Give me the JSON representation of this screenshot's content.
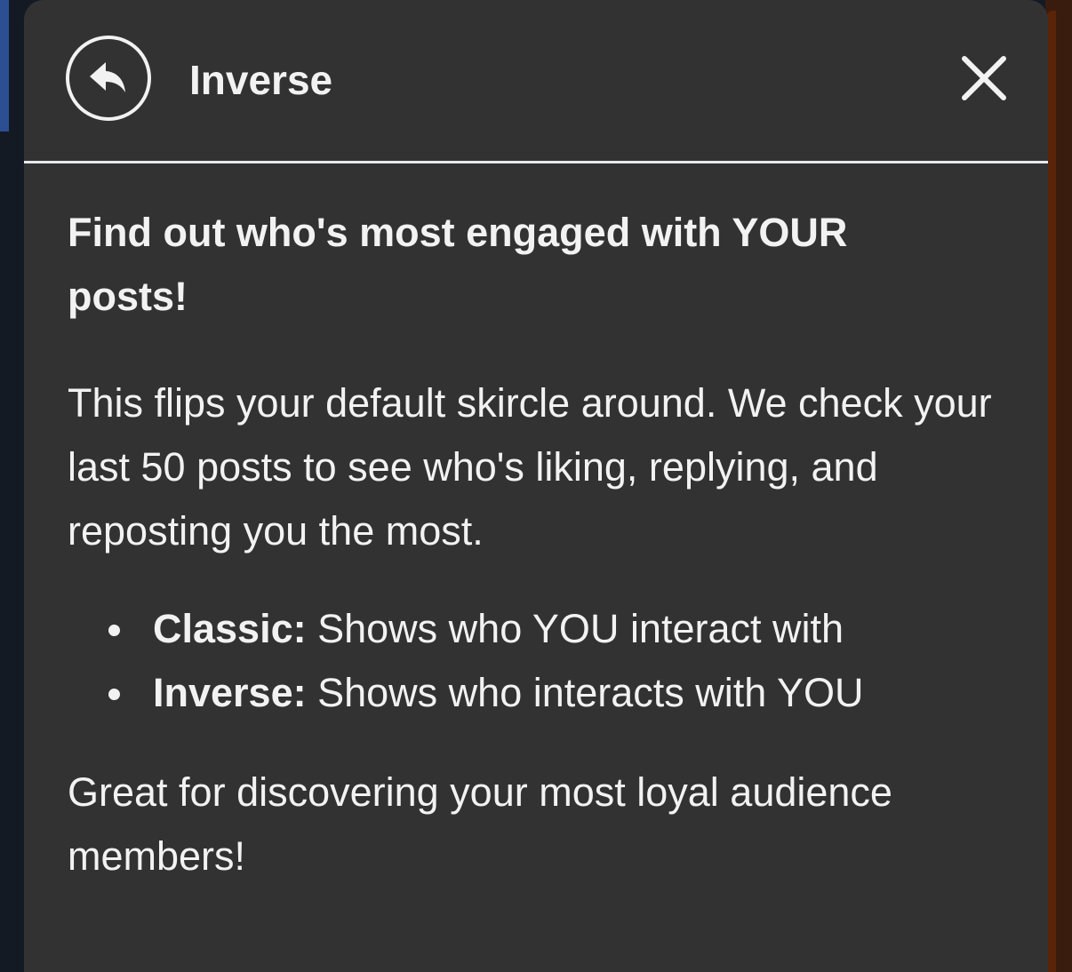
{
  "modal": {
    "title": "Inverse",
    "back_icon": "reply-arrow-icon",
    "close_icon": "close-icon"
  },
  "content": {
    "headline": "Find out who's most engaged with YOUR posts!",
    "description": "This flips your default skircle around. We check your last 50 posts to see who's liking, replying, and reposting you the most.",
    "modes": [
      {
        "name": "Classic:",
        "text": " Shows who YOU interact with"
      },
      {
        "name": "Inverse:",
        "text": " Shows who interacts with YOU"
      }
    ],
    "closing": "Great for discovering your most loyal audience members!"
  },
  "colors": {
    "modal_background": "#323232",
    "text": "#f2f2f2",
    "divider": "#e6e9ee",
    "page_background": "#141a24"
  }
}
